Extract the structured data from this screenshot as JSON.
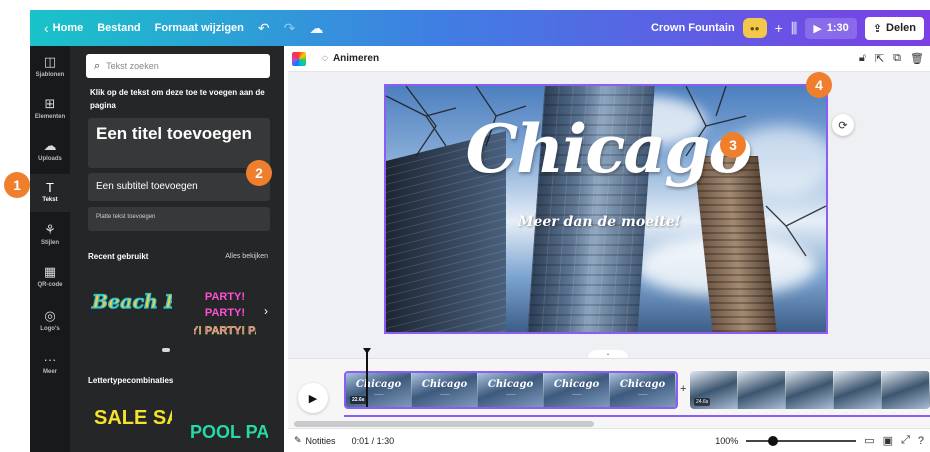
{
  "topbar": {
    "home_label": "Home",
    "file_label": "Bestand",
    "resize_label": "Formaat wijzigen",
    "project_name": "Crown Fountain",
    "play_time": "1:30",
    "share_label": "Delen"
  },
  "rail": {
    "items": [
      {
        "label": "Sjablonen",
        "icon": "template-icon"
      },
      {
        "label": "Elementen",
        "icon": "elements-icon"
      },
      {
        "label": "Uploads",
        "icon": "upload-icon"
      },
      {
        "label": "Tekst",
        "icon": "text-icon"
      },
      {
        "label": "Stijlen",
        "icon": "styles-icon"
      },
      {
        "label": "QR-code",
        "icon": "qr-icon"
      },
      {
        "label": "Logo's",
        "icon": "logo-icon"
      },
      {
        "label": "Meer",
        "icon": "more-icon"
      }
    ]
  },
  "panel": {
    "search_placeholder": "Tekst zoeken",
    "hint": "Klik op de tekst om deze toe te voegen aan de pagina",
    "title_button": "Een titel toevoegen",
    "subtitle_button": "Een subtitel toevoegen",
    "body_button": "Platte tekst toevoegen",
    "recent_heading": "Recent gebruikt",
    "see_all": "Alles bekijken",
    "recent_items": [
      "Beach Please",
      "PARTY! PARTY! PARTY!"
    ],
    "combos_heading": "Lettertypecombinaties",
    "combo_items": [
      "SALE SALE SALE",
      "POOL PARTY"
    ]
  },
  "callouts": [
    "1",
    "2",
    "3",
    "4"
  ],
  "editor": {
    "animate_label": "Animeren",
    "design_title": "Chicago",
    "design_tagline": "Meer dan de moeite!"
  },
  "timeline": {
    "clip_label": "Chicago",
    "clip1_duration": "22.6s",
    "clip2_duration": "24.6s"
  },
  "bottombar": {
    "notes_label": "Notities",
    "timecode": "0:01 / 1:30",
    "zoom": "100%"
  },
  "colors": {
    "accent": "#8b5cf6",
    "callout": "#ef7f2d",
    "panel_bg": "#252627",
    "rail_bg": "#18191b"
  }
}
